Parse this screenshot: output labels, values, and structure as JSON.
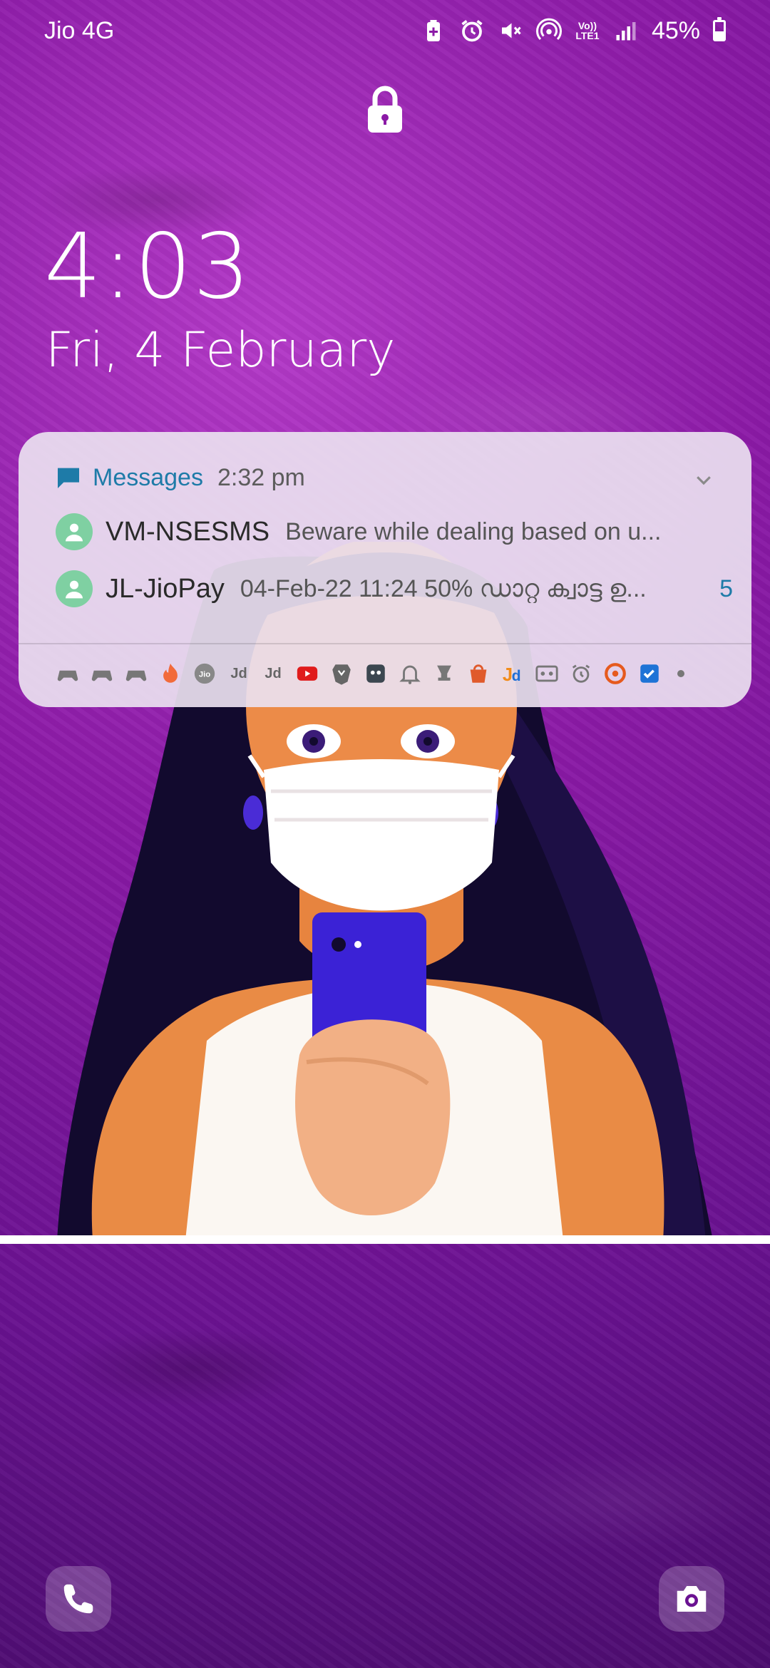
{
  "status_bar": {
    "carrier": "Jio 4G",
    "volte_label": "Vo))\nLTE1",
    "battery_percent": "45%",
    "battery_level": 0.45,
    "icons": [
      "battery-saver-icon",
      "alarm-icon",
      "mute-icon",
      "hotspot-icon",
      "volte-icon",
      "signal-icon",
      "battery-icon"
    ]
  },
  "lock_screen": {
    "time": "4:03",
    "date": "Fri, 4 February"
  },
  "notification": {
    "app_name": "Messages",
    "time": "2:32 pm",
    "items": [
      {
        "sender": "VM-NSESMS",
        "preview": "Beware while dealing based on u...",
        "count": ""
      },
      {
        "sender": "JL-JioPay",
        "preview": "04-Feb-22 11:24 50% ഡാറ്റ ക്വാട്ട ഉ...",
        "count": "5"
      }
    ],
    "app_icons": [
      "gamepad-icon",
      "gamepad-icon",
      "gamepad-icon",
      "tinder-flame-icon",
      "jio-icon",
      "justdial-icon",
      "justdial-icon",
      "youtube-icon",
      "brave-icon",
      "robot-app-icon",
      "bell-icon",
      "trophy-icon",
      "shopping-bag-icon",
      "justdial-color-icon",
      "tape-icon",
      "alarm-clock-icon",
      "target-app-icon",
      "checkbox-app-icon"
    ],
    "app_icon_text": {
      "jio": "Jio",
      "jd": "Jd"
    }
  },
  "shortcuts": {
    "left": "phone-icon",
    "right": "camera-icon"
  },
  "colors": {
    "wallpaper": "#8b1aa6",
    "notif_accent": "#1e7ba8",
    "avatar": "#7fd0a2"
  }
}
